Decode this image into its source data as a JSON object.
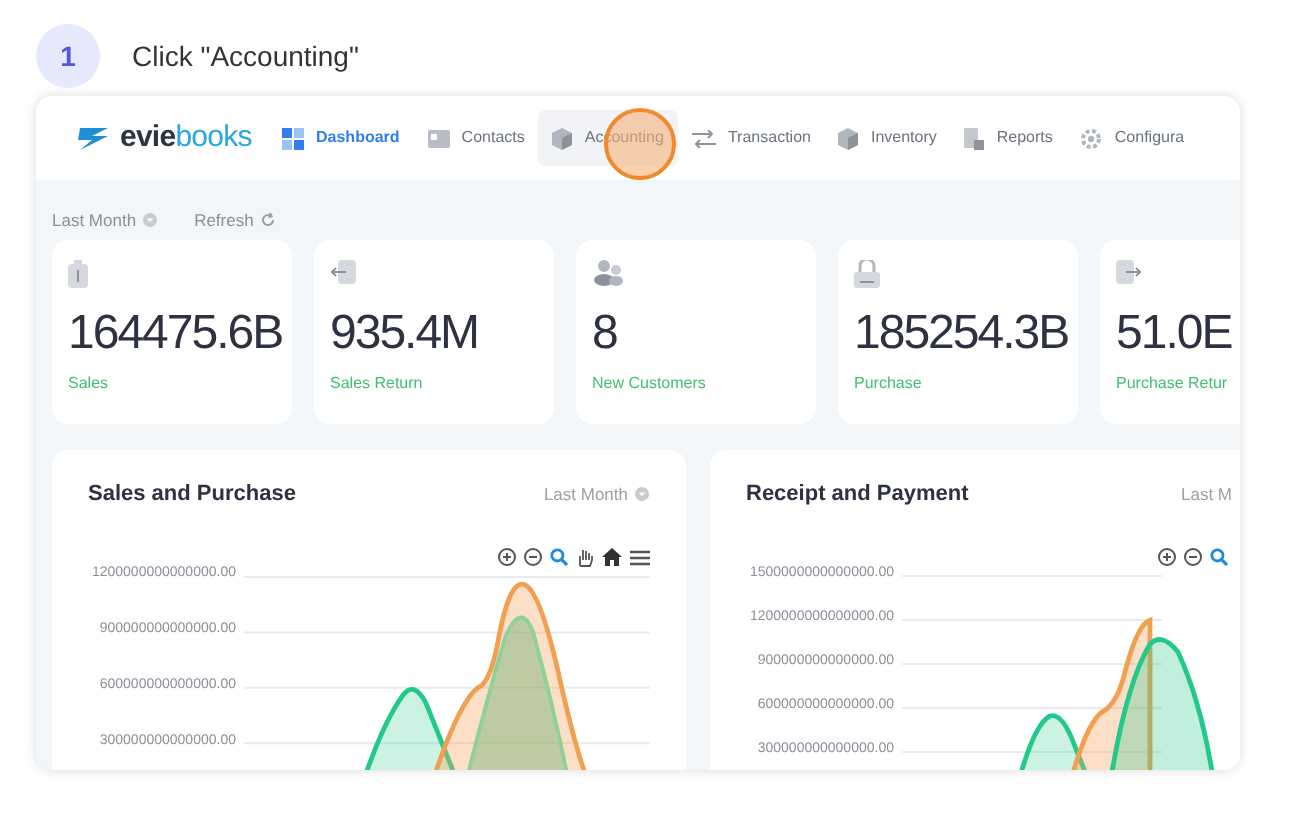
{
  "step": {
    "number": "1",
    "instruction": "Click \"Accounting\""
  },
  "app": {
    "logo": {
      "part_1": "evie",
      "part_2": "books"
    },
    "nav": [
      {
        "label": "Dashboard",
        "selected": true,
        "hovered": false
      },
      {
        "label": "Contacts",
        "selected": false,
        "hovered": false
      },
      {
        "label": "Accounting",
        "selected": false,
        "hovered": true
      },
      {
        "label": "Transaction",
        "selected": false,
        "hovered": false
      },
      {
        "label": "Inventory",
        "selected": false,
        "hovered": false
      },
      {
        "label": "Reports",
        "selected": false,
        "hovered": false
      },
      {
        "label": "Configura",
        "selected": false,
        "hovered": false
      }
    ],
    "click_marker": true,
    "filters": [
      {
        "label": "Last Month"
      },
      {
        "label": "Refresh"
      }
    ],
    "stats": [
      {
        "value": "164475.6B",
        "label": "Sales"
      },
      {
        "value": "935.4M",
        "label": "Sales Return"
      },
      {
        "value": "8",
        "label": "New Customers"
      },
      {
        "value": "185254.3B",
        "label": "Purchase"
      },
      {
        "value": "51.0E",
        "label": "Purchase Retur"
      }
    ],
    "charts": [
      {
        "title": "Sales and Purchase",
        "period": "Last Month",
        "period_caret": true,
        "y_labels": [
          "1200000000000000.00",
          "900000000000000.00",
          "600000000000000.00",
          "300000000000000.00"
        ]
      },
      {
        "title": "Receipt and Payment",
        "period": "Last M",
        "period_caret": false,
        "y_labels": [
          "1500000000000000.00",
          "1200000000000000.00",
          "900000000000000.00",
          "600000000000000.00",
          "300000000000000.00"
        ]
      }
    ]
  }
}
